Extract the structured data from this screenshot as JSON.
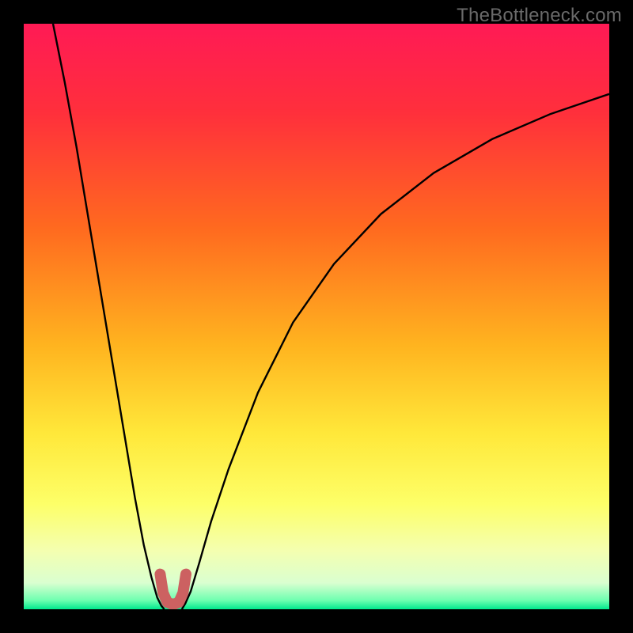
{
  "watermark": "TheBottleneck.com",
  "chart_data": {
    "type": "line",
    "title": "",
    "xlabel": "",
    "ylabel": "",
    "xlim": [
      0,
      100
    ],
    "ylim": [
      0,
      100
    ],
    "grid": false,
    "background": {
      "type": "vertical-gradient",
      "stops": [
        {
          "offset": 0.0,
          "color": "#ff1a55"
        },
        {
          "offset": 0.15,
          "color": "#ff2f3c"
        },
        {
          "offset": 0.35,
          "color": "#ff6a1f"
        },
        {
          "offset": 0.55,
          "color": "#ffb41f"
        },
        {
          "offset": 0.7,
          "color": "#ffe83a"
        },
        {
          "offset": 0.82,
          "color": "#fdff68"
        },
        {
          "offset": 0.9,
          "color": "#f4ffb0"
        },
        {
          "offset": 0.955,
          "color": "#daffd0"
        },
        {
          "offset": 0.985,
          "color": "#6dffb0"
        },
        {
          "offset": 1.0,
          "color": "#00e98d"
        }
      ]
    },
    "series": [
      {
        "name": "left-branch",
        "color": "#000000",
        "width": 2.4,
        "x": [
          5,
          7,
          9,
          11,
          13,
          15,
          17,
          19,
          20.5,
          21.8,
          22.8,
          23.5,
          24.0
        ],
        "y": [
          100,
          90,
          79,
          67,
          55,
          43,
          31,
          19,
          11,
          5.5,
          2.0,
          0.6,
          0.0
        ]
      },
      {
        "name": "right-branch",
        "color": "#000000",
        "width": 2.4,
        "x": [
          27.0,
          27.6,
          28.5,
          30,
          32,
          35,
          40,
          46,
          53,
          61,
          70,
          80,
          90,
          100
        ],
        "y": [
          0.0,
          1.0,
          3.0,
          8,
          15,
          24,
          37,
          49,
          59,
          67.5,
          74.5,
          80.3,
          84.6,
          88.0
        ]
      },
      {
        "name": "highlight-u",
        "color": "#cc6161",
        "width": 14,
        "linecap": "round",
        "x": [
          23.3,
          23.8,
          24.5,
          25.5,
          26.5,
          27.2,
          27.7
        ],
        "y": [
          6.0,
          2.8,
          1.2,
          0.8,
          1.2,
          2.8,
          6.0
        ]
      }
    ]
  }
}
